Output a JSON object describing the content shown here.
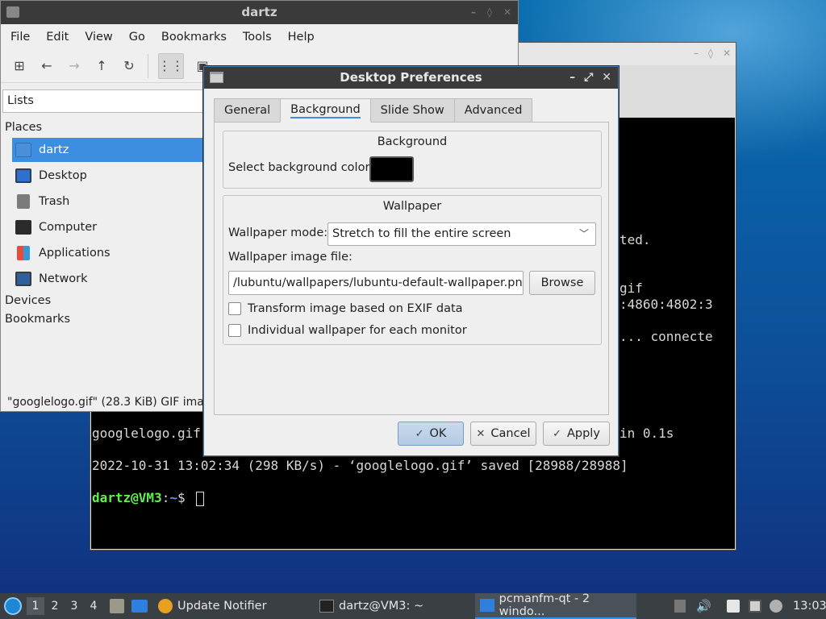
{
  "file_manager": {
    "title": "dartz",
    "menu": [
      "File",
      "Edit",
      "View",
      "Go",
      "Bookmarks",
      "Tools",
      "Help"
    ],
    "side_pane_mode": "Lists",
    "places_header": "Places",
    "places": [
      {
        "label": "dartz",
        "icon": "home-folder-icon",
        "selected": true
      },
      {
        "label": "Desktop",
        "icon": "desktop-icon"
      },
      {
        "label": "Trash",
        "icon": "trash-icon"
      },
      {
        "label": "Computer",
        "icon": "computer-icon"
      },
      {
        "label": "Applications",
        "icon": "applications-icon"
      },
      {
        "label": "Network",
        "icon": "network-icon"
      }
    ],
    "devices_header": "Devices",
    "bookmarks_header": "Bookmarks",
    "status": "\"googlelogo.gif\" (28.3 KiB) GIF image"
  },
  "terminal": {
    "lines": [
      {
        "text": "ted."
      },
      {
        "text": "gif"
      },
      {
        "text": ":4860:4802:3"
      },
      {
        "text": "... connecte"
      },
      {
        "text": "googlelogo.gif"
      },
      {
        "text": "in 0.1s"
      },
      {
        "text": "2022-10-31 13:02:34 (298 KB/s) - ‘googlelogo.gif’ saved [28988/28988]"
      }
    ],
    "prompt_user": "dartz@VM3",
    "prompt_sep": ":",
    "prompt_path": "~",
    "prompt_symbol": "$"
  },
  "dialog": {
    "title": "Desktop Preferences",
    "tabs": [
      {
        "label": "General"
      },
      {
        "label": "Background",
        "active": true
      },
      {
        "label": "Slide Show"
      },
      {
        "label": "Advanced"
      }
    ],
    "background_group": {
      "title": "Background",
      "color_label": "Select background color:",
      "color_value": "#000000"
    },
    "wallpaper_group": {
      "title": "Wallpaper",
      "mode_label": "Wallpaper mode:",
      "mode_value": "Stretch to fill the entire screen",
      "file_label": "Wallpaper image file:",
      "file_value": "/lubuntu/wallpapers/lubuntu-default-wallpaper.png",
      "browse_label": "Browse",
      "exif_label": "Transform image based on EXIF data",
      "exif_checked": false,
      "per_monitor_label": "Individual wallpaper for each monitor",
      "per_monitor_checked": false
    },
    "buttons": {
      "ok": "OK",
      "cancel": "Cancel",
      "apply": "Apply"
    }
  },
  "taskbar": {
    "workspaces": [
      "1",
      "2",
      "3",
      "4"
    ],
    "active_workspace": "1",
    "tasks": [
      {
        "label": "Update Notifier",
        "icon": "update-notifier-icon"
      },
      {
        "label": "dartz@VM3: ~",
        "icon": "terminal-icon"
      },
      {
        "label": "pcmanfm-qt - 2 windo...",
        "icon": "folder-icon",
        "active": true
      }
    ],
    "clock": "13:03"
  }
}
